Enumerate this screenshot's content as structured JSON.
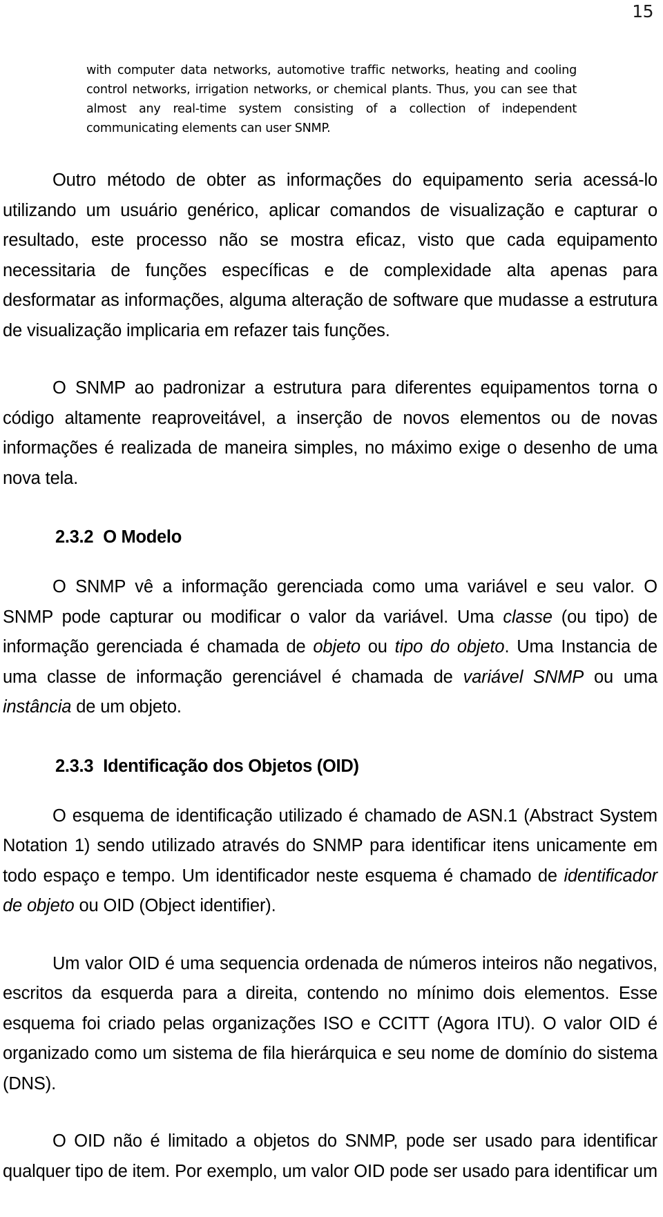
{
  "document": {
    "page_number": "15",
    "language": "pt-BR",
    "quote_block": {
      "text": "with computer data networks, automotive traffic networks, heating and cooling control networks, irrigation networks, or chemical plants. Thus, you can see that almost any real-time system consisting of a collection of independent communicating elements can user SNMP."
    },
    "paragraphs": {
      "p1": {
        "text": "Outro método de obter as informações do equipamento seria acessá-lo utilizando um usuário genérico, aplicar comandos de visualização e capturar o resultado, este processo não se mostra eficaz, visto que cada equipamento necessitaria de funções específicas e de complexidade alta apenas para desformatar as informações, alguma alteração de software que mudasse a estrutura de visualização implicaria em refazer tais funções."
      },
      "p2": {
        "text": "O SNMP ao padronizar a estrutura para diferentes equipamentos torna o código altamente reaproveitável, a inserção de novos elementos ou de novas informações é realizada de maneira simples, no máximo exige o desenho de uma nova tela."
      },
      "p3": {
        "seg1": "O SNMP vê a informação gerenciada como uma variável e seu valor. O SNMP pode capturar ou modificar o valor da variável. Uma ",
        "it1": "classe",
        "seg2": " (ou tipo) de informação gerenciada é chamada de ",
        "it2": "objeto",
        "seg3": " ou ",
        "it3": "tipo do objeto",
        "seg4": ". Uma Instancia de uma classe de informação gerenciável é chamada de ",
        "it4": "variável SNMP",
        "seg5": " ou uma ",
        "it5": "instância",
        "seg6": " de um objeto."
      },
      "p4": {
        "seg1": "O esquema de identificação utilizado é chamado de ASN.1 (Abstract System Notation 1) sendo utilizado através do SNMP para identificar itens unicamente em todo espaço e tempo. Um identificador neste esquema é chamado de ",
        "it1": "identificador de objeto",
        "seg2": " ou OID (Object identifier)."
      },
      "p5": {
        "text": "Um valor OID é uma sequencia ordenada de números inteiros não negativos, escritos da esquerda para a direita, contendo no mínimo dois elementos. Esse esquema foi criado pelas organizações ISO e CCITT (Agora ITU). O valor OID é organizado como um sistema de fila hierárquica e seu nome de domínio do sistema (DNS)."
      },
      "p6": {
        "text": "O OID não é limitado a objetos do SNMP, pode ser usado para identificar qualquer tipo de item. Por exemplo, um valor OID pode ser usado para identificar um"
      }
    },
    "headings": {
      "h1": {
        "number": "2.3.2",
        "title": "O Modelo"
      },
      "h2": {
        "number": "2.3.3",
        "title": "Identificação dos Objetos (OID)"
      }
    }
  }
}
